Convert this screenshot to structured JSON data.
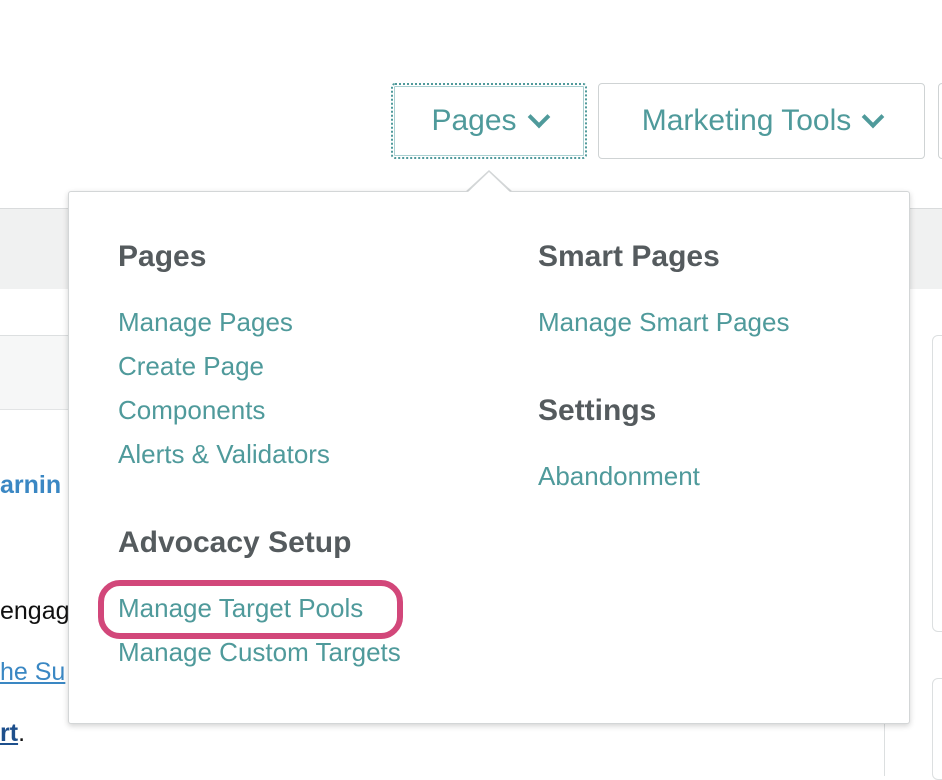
{
  "nav": {
    "pages_label": "Pages",
    "marketing_tools_label": "Marketing Tools"
  },
  "background": {
    "heading_fragment": "arnin",
    "body_fragment": "engag",
    "link_fragment": "he Su",
    "link2_fragment": "rt",
    "link2_punct": "."
  },
  "dropdown": {
    "pages": {
      "heading": "Pages",
      "items": [
        "Manage Pages",
        "Create Page",
        "Components",
        "Alerts & Validators"
      ]
    },
    "advocacy": {
      "heading": "Advocacy Setup",
      "items": [
        "Manage Target Pools",
        "Manage Custom Targets"
      ]
    },
    "smart_pages": {
      "heading": "Smart Pages",
      "items": [
        "Manage Smart Pages"
      ]
    },
    "settings": {
      "heading": "Settings",
      "items": [
        "Abandonment"
      ]
    }
  },
  "colors": {
    "accent": "#4f9a9b",
    "heading": "#555b5e",
    "highlight": "#d2477a",
    "link_blue": "#3a87c3"
  },
  "icons": {
    "pages_chevron": "chevron-down-icon",
    "marketing_chevron": "chevron-down-icon"
  }
}
